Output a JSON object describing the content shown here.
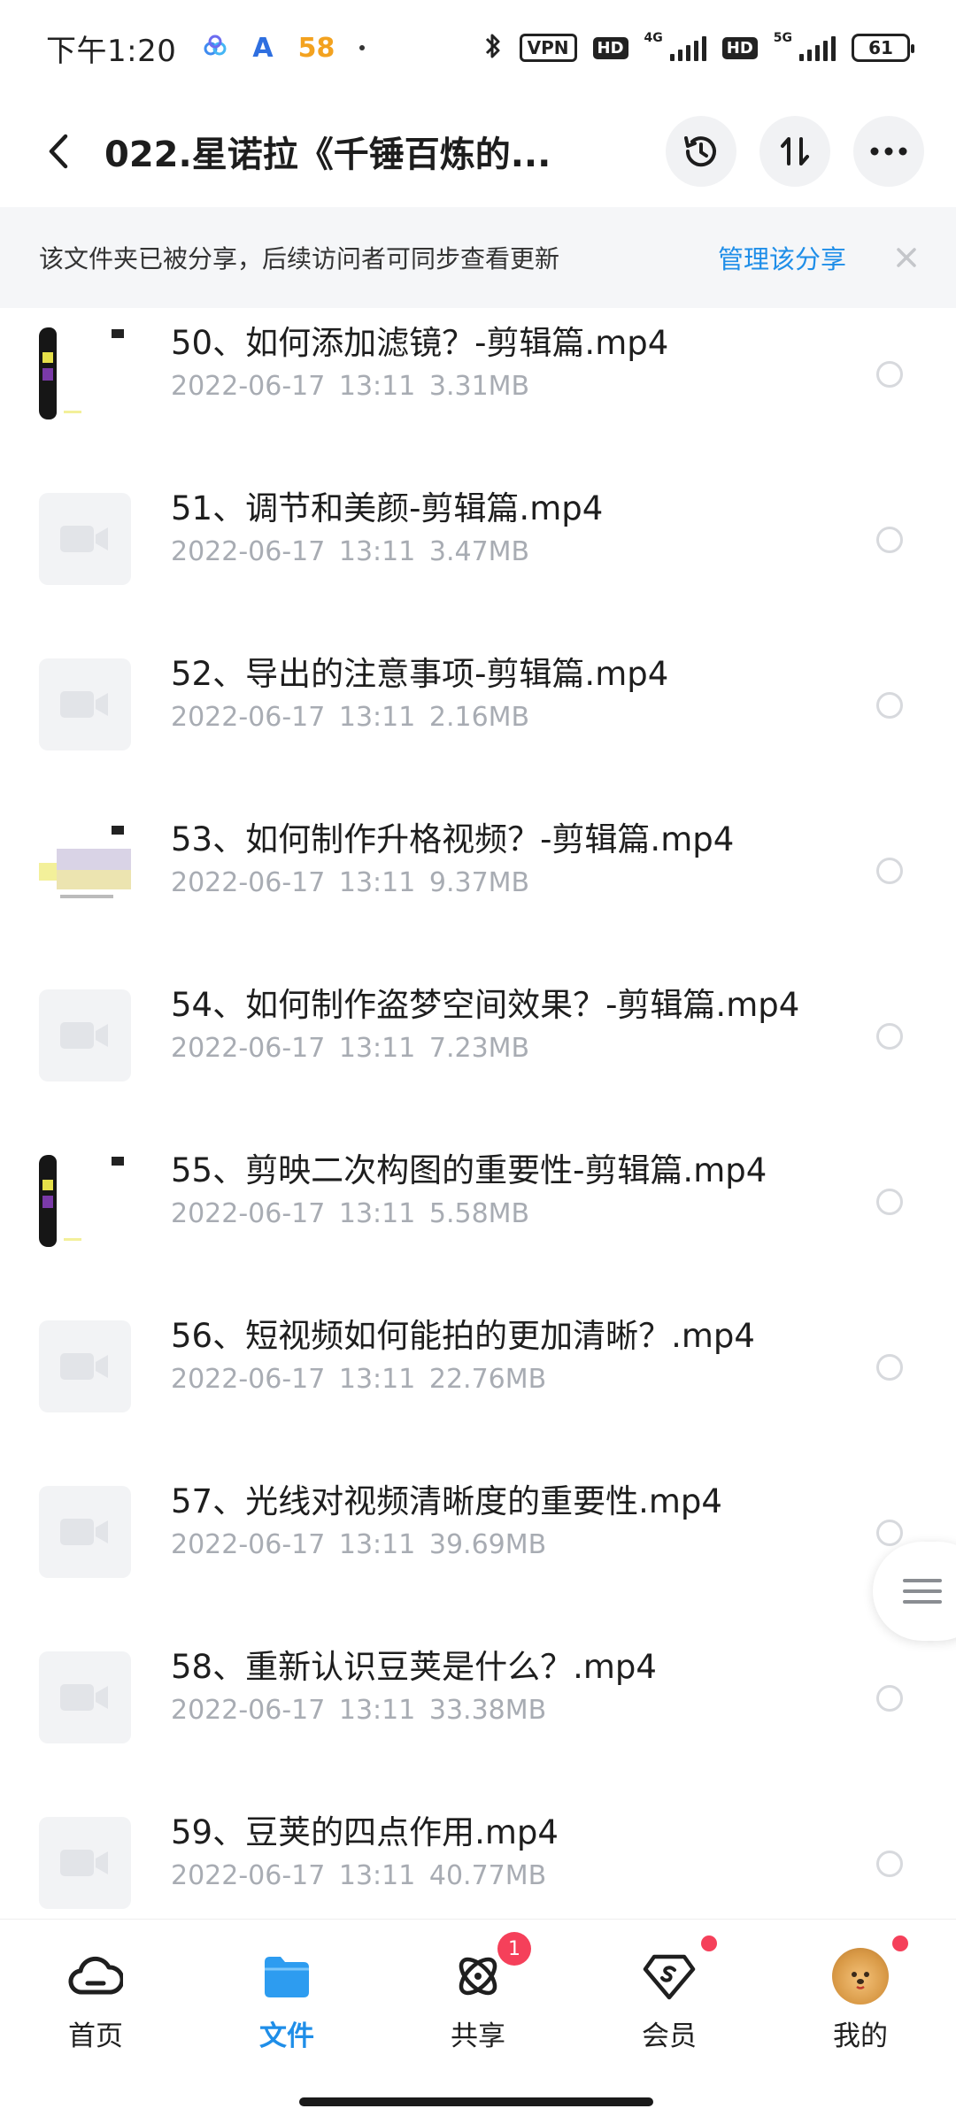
{
  "status": {
    "time": "下午1:20",
    "app_icons": [
      "A",
      "58"
    ],
    "vpn": "VPN",
    "hd1": "HD",
    "net1": "4G",
    "hd2": "HD",
    "net2": "5G",
    "battery": "61"
  },
  "header": {
    "title": "022.星诺拉《千锤百炼的..."
  },
  "banner": {
    "text": "该文件夹已被分享，后续访问者可同步查看更新",
    "link": "管理该分享"
  },
  "files": [
    {
      "name": "50、如何添加滤镜？-剪辑篇.mp4",
      "meta": "2022-06-17  13:11  3.31MB",
      "thumb": "photo-dark"
    },
    {
      "name": "51、调节和美颜-剪辑篇.mp4",
      "meta": "2022-06-17  13:11  3.47MB",
      "thumb": "video"
    },
    {
      "name": "52、导出的注意事项-剪辑篇.mp4",
      "meta": "2022-06-17  13:11  2.16MB",
      "thumb": "video"
    },
    {
      "name": "53、如何制作升格视频？-剪辑篇.mp4",
      "meta": "2022-06-17  13:11  9.37MB",
      "thumb": "photo-light"
    },
    {
      "name": "54、如何制作盗梦空间效果？-剪辑篇.mp4",
      "meta": "2022-06-17  13:11  7.23MB",
      "thumb": "video"
    },
    {
      "name": "55、剪映二次构图的重要性-剪辑篇.mp4",
      "meta": "2022-06-17  13:11  5.58MB",
      "thumb": "photo-dark"
    },
    {
      "name": "56、短视频如何能拍的更加清晰？.mp4",
      "meta": "2022-06-17  13:11  22.76MB",
      "thumb": "video"
    },
    {
      "name": "57、光线对视频清晰度的重要性.mp4",
      "meta": "2022-06-17  13:11  39.69MB",
      "thumb": "video"
    },
    {
      "name": "58、重新认识豆荚是什么？.mp4",
      "meta": "2022-06-17  13:11  33.38MB",
      "thumb": "video"
    },
    {
      "name": "59、豆荚的四点作用.mp4",
      "meta": "2022-06-17  13:11  40.77MB",
      "thumb": "video"
    }
  ],
  "nav": {
    "home": "首页",
    "files": "文件",
    "share": "共享",
    "share_badge": "1",
    "member": "会员",
    "mine": "我的"
  },
  "colors": {
    "accent": "#1f8ee8",
    "badge": "#f5405a"
  }
}
